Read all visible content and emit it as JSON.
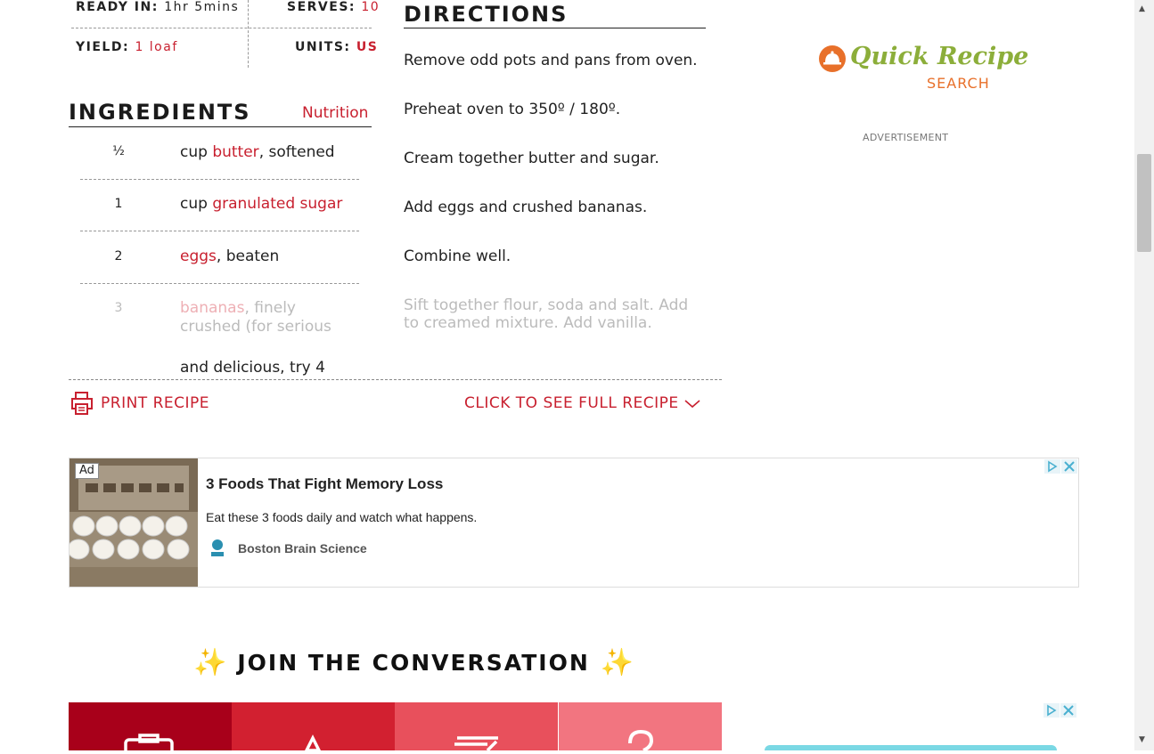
{
  "recipe_meta": {
    "ready_in_label": "READY IN:",
    "ready_in_value": "1hr 5mins",
    "serves_label": "SERVES:",
    "serves_value": "10",
    "yield_label": "YIELD:",
    "yield_value": "1 loaf",
    "units_label": "UNITS:",
    "units_value": "US"
  },
  "ingredients": {
    "heading": "INGREDIENTS",
    "nutrition_link": "Nutrition",
    "items": [
      {
        "qty": "½",
        "pre": "cup ",
        "link": "butter",
        "post": ", softened"
      },
      {
        "qty": "1",
        "pre": "cup ",
        "link": "granulated sugar",
        "post": ""
      },
      {
        "qty": "2",
        "pre": "",
        "link": "eggs",
        "post": ", beaten"
      },
      {
        "qty": "3",
        "pre": "",
        "link": "bananas",
        "post": ", finely crushed (for serious"
      },
      {
        "qty": "",
        "pre": "",
        "link": "",
        "post": "and delicious, try 4"
      }
    ]
  },
  "directions": {
    "heading": "DIRECTIONS",
    "steps": [
      "Remove odd pots and pans from oven.",
      "Preheat oven to 350º / 180º.",
      "Cream together butter and sugar.",
      "Add eggs and crushed bananas.",
      "Combine well.",
      "Sift together flour, soda and salt. Add to creamed mixture. Add vanilla."
    ]
  },
  "actions": {
    "print_label": "PRINT RECIPE",
    "full_recipe_label": "CLICK TO SEE FULL RECIPE"
  },
  "sidebar": {
    "logo_line1": "Quick Recipe",
    "logo_line2": "SEARCH",
    "ad_label": "ADVERTISEMENT"
  },
  "ad": {
    "badge": "Ad",
    "title": "3 Foods That Fight Memory Loss",
    "description": "Eat these 3 foods daily and watch what happens.",
    "advertiser": "Boston Brain Science"
  },
  "conversation": {
    "heading": "JOIN THE CONVERSATION",
    "sparkle": "✨"
  },
  "icon_tiles": [
    {
      "name": "camera-icon",
      "color": "#a8001a"
    },
    {
      "name": "star-icon",
      "color": "#d22030"
    },
    {
      "name": "review-icon",
      "color": "#e8505c"
    },
    {
      "name": "question-icon",
      "color": "#f27580"
    }
  ],
  "colors": {
    "accent": "#c8202f",
    "ad_choices": "#4ab0d0",
    "teal_ad": "#7ad8e4"
  }
}
